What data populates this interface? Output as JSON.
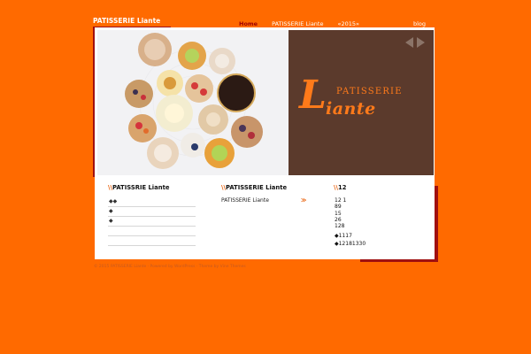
{
  "site": {
    "title": "PATISSERIE Liante"
  },
  "nav": {
    "items": [
      {
        "label": "Home",
        "active": true
      },
      {
        "label": "PATISSERIE Liante",
        "active": false
      },
      {
        "label": "«2015»",
        "active": false
      }
    ],
    "blog_label": "blog"
  },
  "hero": {
    "brand_word": "PATISSERIE",
    "brand_script_initial": "L",
    "brand_script_rest": "iante",
    "panel_color": "#5b3a2c",
    "accent_color": "#ff7a1a"
  },
  "columns": {
    "col1": {
      "heading_prefix": "\\\\",
      "heading": "PATISSRIE Liante",
      "items": [
        "◆◆",
        "◆",
        "◆",
        "",
        ""
      ]
    },
    "col2": {
      "heading_prefix": "\\\\",
      "heading": "PATISSERIE Liante",
      "link": "PATISSERIE Liante",
      "more": "≫"
    },
    "col3": {
      "heading_prefix": "\\\\",
      "heading": "12",
      "lines": [
        "12 1",
        "89",
        "15",
        "26",
        "128"
      ],
      "extra": [
        "◆1117",
        "◆12181330"
      ]
    }
  },
  "footer": {
    "credit": "© 2015 PATISSERIE Liante · Powered by WordPress · Theme by Vine Themes"
  },
  "colors": {
    "background": "#ff6a00",
    "frame_accent": "#a01010",
    "active_nav": "#a00000"
  }
}
